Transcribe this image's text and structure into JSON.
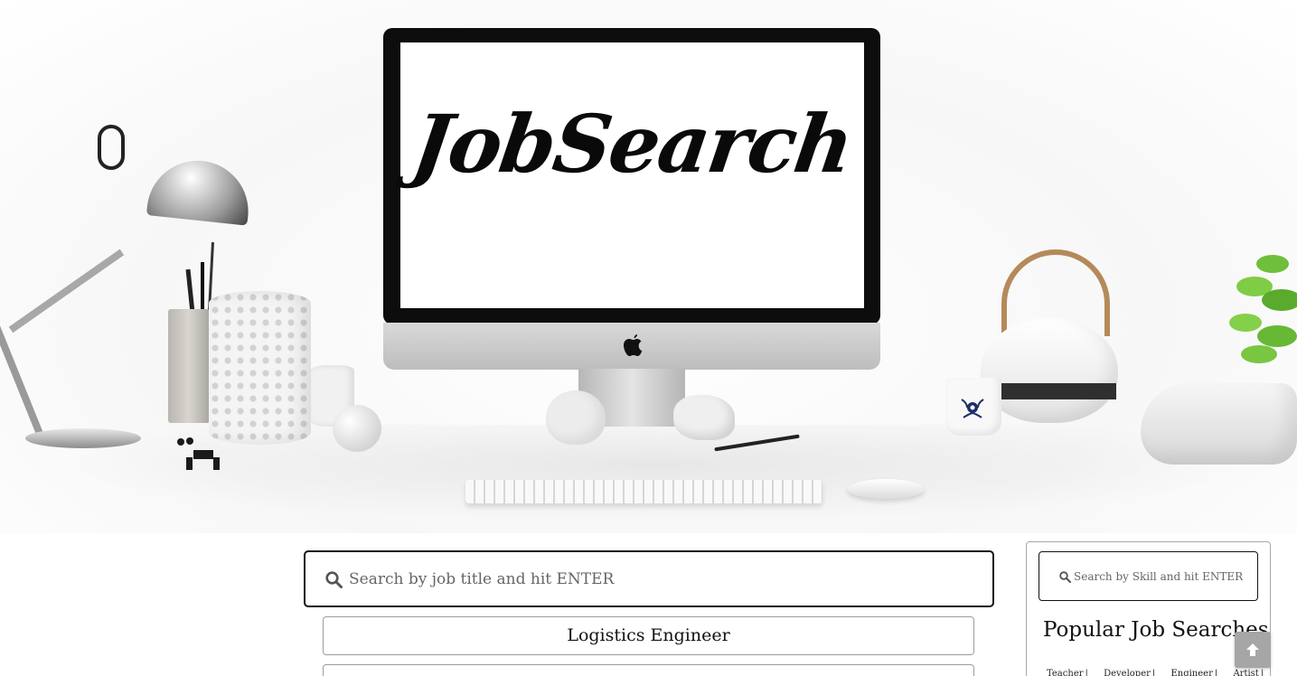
{
  "hero": {
    "logo_text": "JobSearch"
  },
  "search": {
    "placeholder": "Search by job title and hit ENTER",
    "icon": "search-icon"
  },
  "results": [
    {
      "title": "Logistics Engineer"
    },
    {
      "title": ""
    }
  ],
  "sidebar": {
    "skill_search_placeholder": "Search by Skill and hit ENTER",
    "popular_title": "Popular Job Searches",
    "popular_links": [
      "Teacher",
      "Developer",
      "Engineer",
      "Artist"
    ],
    "separator": "|"
  },
  "scroll_top": {
    "icon": "arrow-up-icon"
  }
}
